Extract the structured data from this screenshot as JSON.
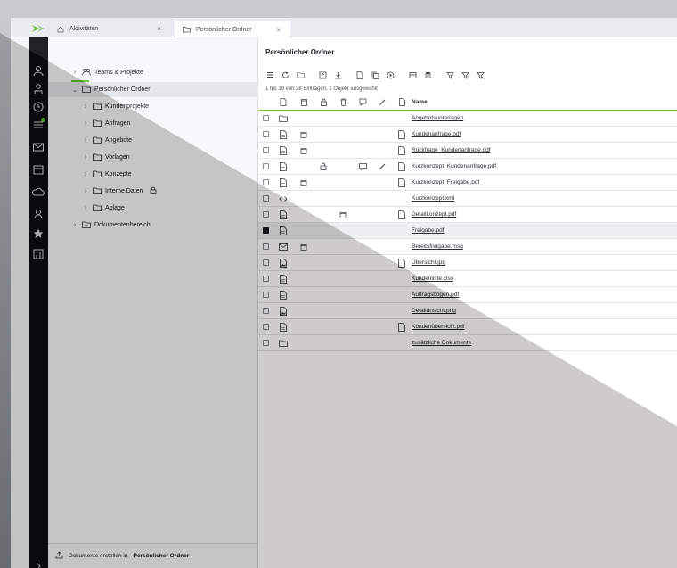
{
  "tabs": [
    {
      "label": "Aktivitäten",
      "icon": "home-icon"
    },
    {
      "label": "Persönlicher Ordner",
      "icon": "folder-icon"
    }
  ],
  "tree": {
    "items": [
      {
        "label": "Teams & Projekte",
        "icon": "teams-icon",
        "level": 0,
        "chevron": "›"
      },
      {
        "label": "Persönlicher Ordner",
        "icon": "folder-icon",
        "level": 0,
        "chevron": "⌄",
        "selected": true
      },
      {
        "label": "Kundenprojekte",
        "icon": "folder-icon",
        "level": 1,
        "chevron": "›"
      },
      {
        "label": "Anfragen",
        "icon": "folder-icon",
        "level": 1,
        "chevron": "›"
      },
      {
        "label": "Angebote",
        "icon": "folder-icon",
        "level": 1,
        "chevron": "›"
      },
      {
        "label": "Vorlagen",
        "icon": "folder-icon",
        "level": 1,
        "chevron": "›"
      },
      {
        "label": "Konzepte",
        "icon": "folder-icon",
        "level": 1,
        "chevron": "›"
      },
      {
        "label": "Interne Daten",
        "icon": "folder-icon",
        "level": 1,
        "chevron": "›",
        "locked": true
      },
      {
        "label": "Ablage",
        "icon": "folder-icon",
        "level": 1,
        "chevron": "›"
      },
      {
        "label": "Dokumentenbereich",
        "icon": "archive-icon",
        "level": 0,
        "chevron": "›"
      }
    ],
    "footer_text": "Dokumente erstellen in",
    "footer_bold": "Persönlicher Ordner"
  },
  "main": {
    "title": "Persönlicher Ordner",
    "count_text": "1 bis 19 von 28 Einträgen, 1 Objekt ausgewählt",
    "name_header": "Name"
  },
  "rows": [
    {
      "name": "Angebotsunterlagen",
      "type": "folder",
      "locked": false,
      "deleted": false,
      "comment": false,
      "edit": false,
      "preview": false,
      "checked": false
    },
    {
      "name": "Kundenanfrage.pdf",
      "type": "file",
      "deleted": true,
      "preview": true,
      "checked": false
    },
    {
      "name": "Rückfrage_Kundenanfrage.pdf",
      "type": "file",
      "deleted": true,
      "preview": true,
      "checked": false
    },
    {
      "name": "Kurzkonzept_Kundenanfrage.pdf",
      "type": "file",
      "locked": true,
      "comment": true,
      "edit": true,
      "preview": true,
      "checked": false
    },
    {
      "name": "Kurzkonzept_Freigabe.pdf",
      "type": "file",
      "deleted": true,
      "preview": true,
      "checked": false
    },
    {
      "name": "Kurzkonzept.xml",
      "type": "code",
      "checked": false
    },
    {
      "name": "Detailkonzept.pdf",
      "type": "file",
      "deleted2": true,
      "preview": true,
      "checked": false
    },
    {
      "name": "Freigabe.pdf",
      "type": "file",
      "checked": true,
      "selected": true
    },
    {
      "name": "Bereitsfreigabe.msg",
      "type": "mail",
      "deleted": true,
      "checked": false
    },
    {
      "name": "Übersicht.jpg",
      "type": "image",
      "preview": true,
      "checked": false
    },
    {
      "name": "Kundenliste.xlsx",
      "type": "file",
      "checked": false
    },
    {
      "name": "Auftragsbögen.pdf",
      "type": "file",
      "checked": false
    },
    {
      "name": "Detailansicht.png",
      "type": "image",
      "checked": false
    },
    {
      "name": "Kundenübersicht.pdf",
      "type": "file",
      "preview": true,
      "checked": false
    },
    {
      "name": "zusätzliche Dokumente",
      "type": "folder",
      "checked": false
    }
  ],
  "colors": {
    "accent": "#6cc24a",
    "rail": "#1f2326"
  }
}
